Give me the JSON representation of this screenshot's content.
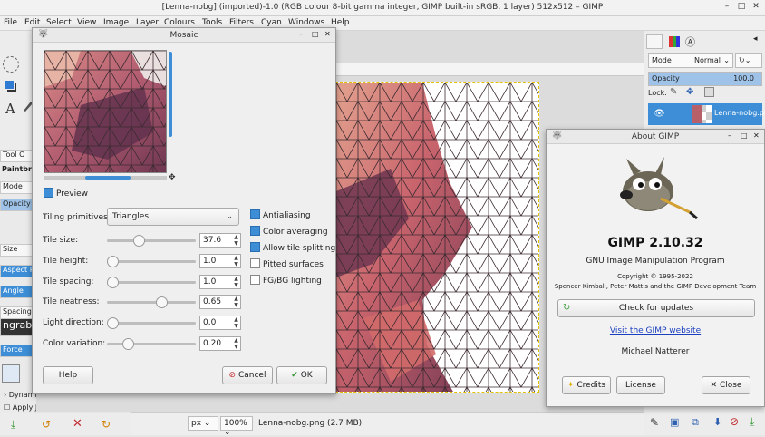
{
  "window": {
    "title": "[Lenna-nobg] (imported)-1.0 (RGB colour 8-bit gamma integer, GIMP built-in sRGB, 1 layer) 512x512 – GIMP"
  },
  "menu": [
    "File",
    "Edit",
    "Select",
    "View",
    "Image",
    "Layer",
    "Colours",
    "Tools",
    "Filters",
    "Cyan",
    "Windows",
    "Help"
  ],
  "toolbox": {
    "tool_options_tab": "Tool O",
    "paintbrush_label": "Paintbrus",
    "mode_label": "Mode",
    "opacity_label": "Opacity",
    "size_label": "Size",
    "aspect_label": "Aspect R",
    "angle_label": "Angle",
    "spacing_label": "Spacing",
    "brush_name": "ngrab",
    "force_label": "Force",
    "dynamics_label": "Dynamics Options",
    "apply_jitter_label": "Apply Jitter"
  },
  "statusbar": {
    "unit": "px",
    "zoom": "100%",
    "file_info": "Lenna-nobg.png (2.7 MB)"
  },
  "dock": {
    "mode_label": "Mode",
    "mode_value": "Normal",
    "opacity_label": "Opacity",
    "opacity_value": "100.0",
    "lock_label": "Lock:",
    "layer_name": "Lenna-nobg.pn"
  },
  "mosaic": {
    "title": "Mosaic",
    "preview_label": "Preview",
    "tiling_label": "Tiling primitives:",
    "tiling_value": "Triangles",
    "params": [
      {
        "label": "Tile size:",
        "value": "37.6",
        "fraction": 0.36
      },
      {
        "label": "Tile height:",
        "value": "1.0",
        "fraction": 0.06
      },
      {
        "label": "Tile spacing:",
        "value": "1.0",
        "fraction": 0.06
      },
      {
        "label": "Tile neatness:",
        "value": "0.65",
        "fraction": 0.62
      },
      {
        "label": "Light direction:",
        "value": "0.0",
        "fraction": 0.06
      },
      {
        "label": "Color variation:",
        "value": "0.20",
        "fraction": 0.22
      }
    ],
    "options": [
      {
        "label": "Antialiasing",
        "checked": true
      },
      {
        "label": "Color averaging",
        "checked": true
      },
      {
        "label": "Allow tile splitting",
        "checked": true
      },
      {
        "label": "Pitted surfaces",
        "checked": false
      },
      {
        "label": "FG/BG lighting",
        "checked": false
      }
    ],
    "help_label": "Help",
    "cancel_label": "Cancel",
    "ok_label": "OK"
  },
  "about": {
    "title": "About GIMP",
    "product": "GIMP 2.10.32",
    "subtitle": "GNU Image Manipulation Program",
    "copyright": "Copyright © 1995-2022",
    "authors": "Spencer Kimball, Peter Mattis and the GIMP Development Team",
    "check_updates_label": "Check for updates",
    "website_label": "Visit the GIMP website",
    "author_name": "Michael Natterer",
    "credits_label": "Credits",
    "license_label": "License",
    "close_label": "Close"
  },
  "colors": {
    "accent": "#3d8ed6",
    "link": "#1a3fbf",
    "skin_dark": "#7a3b54",
    "skin_light": "#e8a58f"
  }
}
